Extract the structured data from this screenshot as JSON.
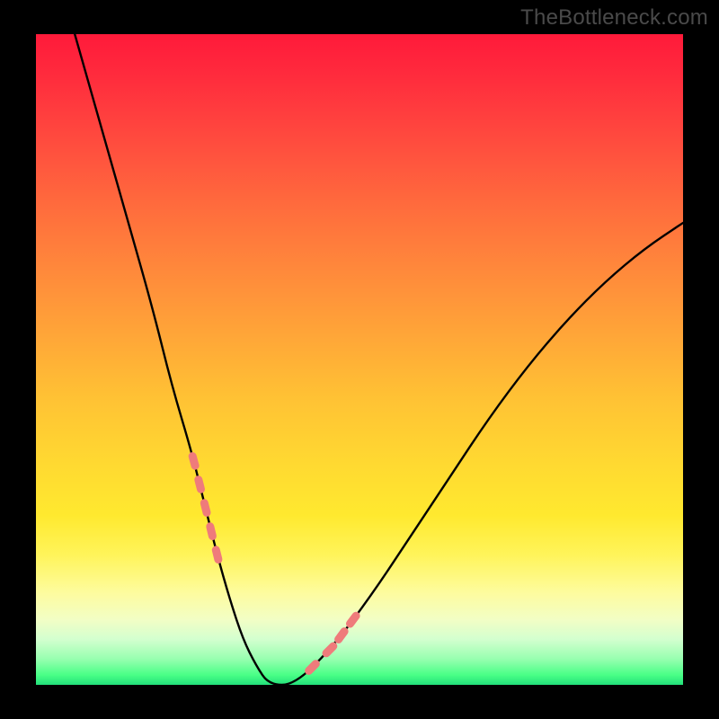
{
  "watermark": {
    "text": "TheBottleneck.com"
  },
  "chart_data": {
    "type": "line",
    "title": "",
    "xlabel": "",
    "ylabel": "",
    "xlim": [
      0,
      100
    ],
    "ylim": [
      0,
      100
    ],
    "grid": false,
    "legend": false,
    "series": [
      {
        "name": "bottleneck-curve",
        "x": [
          6,
          10,
          14,
          18,
          21,
          24,
          26,
          28,
          30,
          32,
          34,
          36,
          40,
          46,
          52,
          58,
          64,
          70,
          76,
          82,
          88,
          94,
          100
        ],
        "y": [
          100,
          86,
          72,
          58,
          46,
          36,
          28,
          20,
          13,
          7,
          3,
          0,
          0,
          6,
          14,
          23,
          32,
          41,
          49,
          56,
          62,
          67,
          71
        ],
        "note": "Values are approximate, read off pixel positions. y is percent height from bottom (0 = bottom edge). Curve minimum ~0 at x≈36–40."
      }
    ],
    "markers": {
      "name": "highlight-dashes",
      "color": "#f07878",
      "left_branch_x_range": [
        23.5,
        28.5
      ],
      "right_branch_x_range": [
        40,
        50
      ],
      "note": "Short salmon dashes overlaid on the curve in the lower region on both the descending and ascending branches."
    },
    "background_gradient": {
      "stops": [
        {
          "pos": 0.0,
          "color": "#ff1a3a"
        },
        {
          "pos": 0.36,
          "color": "#ff883b"
        },
        {
          "pos": 0.66,
          "color": "#ffd931"
        },
        {
          "pos": 0.86,
          "color": "#fdfca0"
        },
        {
          "pos": 0.96,
          "color": "#98ffb0"
        },
        {
          "pos": 1.0,
          "color": "#22e07a"
        }
      ]
    }
  }
}
